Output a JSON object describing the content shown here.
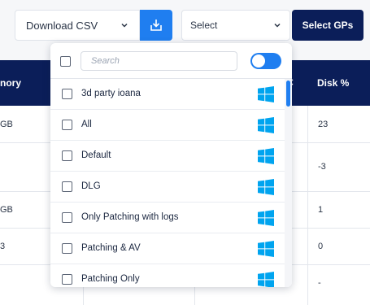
{
  "toolbar": {
    "csv_select_value": "Download CSV",
    "gp_select_value": "Select",
    "select_gps_label": "Select GPs",
    "download_icon": "download-tray-icon"
  },
  "table": {
    "header_memory": "nory",
    "header_disk": "Disk %",
    "rows": [
      {
        "c1": "GB",
        "c2": "23"
      },
      {
        "c1": "",
        "c2": "-3"
      },
      {
        "c1": "GB",
        "c2": "1"
      },
      {
        "c1": "3",
        "c2": "0"
      },
      {
        "c1": "",
        "c2": "-"
      }
    ]
  },
  "dropdown": {
    "search_placeholder": "Search",
    "toggle_on": true,
    "items": [
      {
        "label": "3d party ioana",
        "icon": "windows-icon"
      },
      {
        "label": "All",
        "icon": "windows-icon"
      },
      {
        "label": "Default",
        "icon": "windows-icon"
      },
      {
        "label": "DLG",
        "icon": "windows-icon"
      },
      {
        "label": "Only Patching with logs",
        "icon": "windows-icon"
      },
      {
        "label": "Patching & AV",
        "icon": "windows-icon"
      },
      {
        "label": "Patching Only",
        "icon": "windows-icon"
      }
    ]
  },
  "colors": {
    "accent": "#1f7ef0",
    "navy": "#0b1e59",
    "windows_blue": "#00a4ef"
  }
}
